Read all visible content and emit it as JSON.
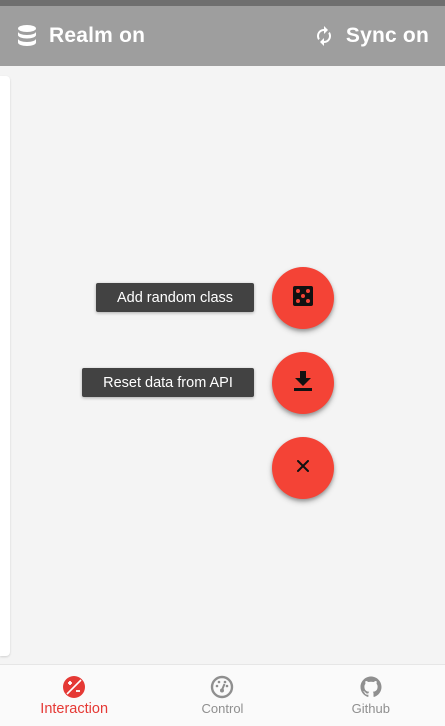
{
  "app_bar": {
    "left_label": "Realm on",
    "left_icon": "database-icon",
    "right_label": "Sync on",
    "right_icon": "sync-icon"
  },
  "speed_dial": {
    "actions": [
      {
        "label": "Add random class",
        "icon": "dice-icon"
      },
      {
        "label": "Reset data from API",
        "icon": "download-icon"
      }
    ],
    "close_icon": "close-icon"
  },
  "bottom_nav": {
    "items": [
      {
        "label": "Interaction",
        "icon": "interaction-icon",
        "active": true
      },
      {
        "label": "Control",
        "icon": "speedometer-icon",
        "active": false
      },
      {
        "label": "Github",
        "icon": "github-icon",
        "active": false
      }
    ]
  },
  "colors": {
    "app_bar": "#9e9e9e",
    "fab": "#f44336",
    "label_bg": "#424242",
    "active_nav": "#e53935",
    "inactive_nav": "#8f8f8f"
  }
}
